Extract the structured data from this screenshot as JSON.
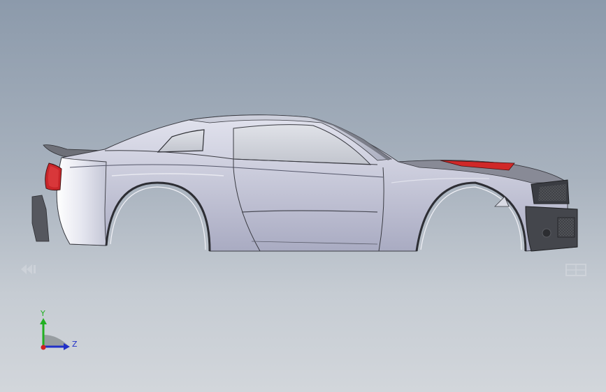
{
  "viewport": {
    "background_top": "#8c9aab",
    "background_bottom": "#d2d6db"
  },
  "model": {
    "body_color": "#c8cad8",
    "body_shadow_color": "#9ea2b8",
    "grille_color": "#3a3c40",
    "taillight_color": "#c8262a",
    "hood_vent_color": "#d02828",
    "glass_color": "#d4d6de"
  },
  "triad": {
    "y_label": "Y",
    "z_label": "Z",
    "y_color": "#22b022",
    "z_color": "#2030c8",
    "x_color": "#d02020"
  },
  "nav": {
    "left_icon": "previous-view-icon",
    "right_icon": "view-orientation-icon"
  }
}
